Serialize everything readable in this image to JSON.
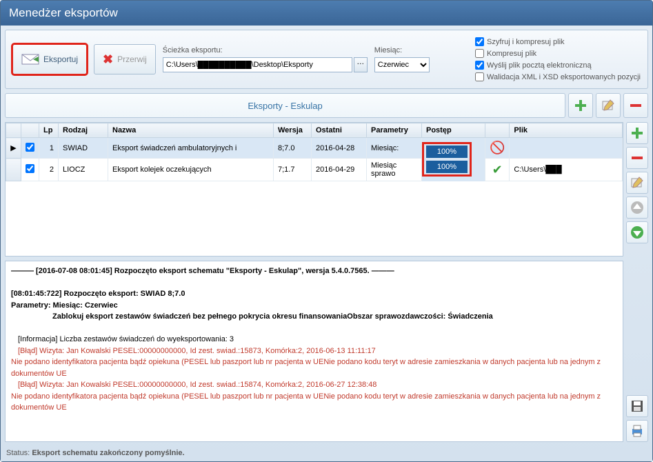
{
  "window": {
    "title": "Menedżer eksportów"
  },
  "toolbar": {
    "export_label": "Eksportuj",
    "cancel_label": "Przerwij",
    "path_label": "Ścieżka eksportu:",
    "path_value": "C:\\Users\\██████████\\Desktop\\Eksporty",
    "month_label": "Miesiąc:",
    "month_value": "Czerwiec"
  },
  "checks": {
    "encrypt": {
      "label": "Szyfruj i kompresuj plik",
      "checked": true
    },
    "compress": {
      "label": "Kompresuj plik",
      "checked": false
    },
    "email": {
      "label": "Wyślij plik pocztą elektroniczną",
      "checked": true
    },
    "validate": {
      "label": "Walidacja XML i XSD eksportowanych pozycji",
      "checked": false
    }
  },
  "schema": {
    "name": "Eksporty - Eskulap"
  },
  "grid": {
    "headers": {
      "lp": "Lp",
      "rodzaj": "Rodzaj",
      "nazwa": "Nazwa",
      "wersja": "Wersja",
      "ostatni": "Ostatni",
      "parametry": "Parametry",
      "postep": "Postęp",
      "plik": "Plik"
    },
    "rows": [
      {
        "selected": true,
        "checked": true,
        "lp": "1",
        "rodzaj": "SWIAD",
        "nazwa": "Eksport świadczeń ambulatoryjnych i",
        "wersja": "8;7.0",
        "ostatni": "2016-04-28",
        "parametry": "Miesiąc:",
        "postep": "100%",
        "status": "error",
        "plik": ""
      },
      {
        "selected": false,
        "checked": true,
        "lp": "2",
        "rodzaj": "LIOCZ",
        "nazwa": "Eksport kolejek oczekujących",
        "wersja": "7;1.7",
        "ostatni": "2016-04-29",
        "parametry": "Miesiąc sprawo",
        "postep": "100%",
        "status": "ok",
        "plik": "C:\\Users\\███"
      }
    ]
  },
  "log": {
    "line1": "——— [2016-07-08 08:01:45] Rozpoczęto eksport schematu \"Eksporty - Eskulap\", wersja 5.4.0.7565. ———",
    "line2": "[08:01:45:722] Rozpoczęto eksport: SWIAD 8;7.0",
    "line3": "Parametry: Miesiąc: Czerwiec",
    "line4": "Zablokuj eksport zestawów świadczeń bez pełnego pokrycia okresu finansowaniaObszar sprawozdawczości: Świadczenia",
    "line5": "[Informacja] Liczba zestawów świadczeń do wyeksportowania: 3",
    "err1": "[Błąd] Wizyta: Jan Kowalski PESEL:00000000000, Id zest. swiad.:15873, Komórka:2, 2016-06-13 11:11:17",
    "err1b": "Nie podano identyfikatora pacjenta bądź opiekuna (PESEL lub paszport lub nr pacjenta w UENie podano kodu teryt w adresie zamieszkania w danych pacjenta lub na jednym z dokumentów UE",
    "err2": "[Błąd] Wizyta: Jan Kowalski PESEL:00000000000, Id zest. swiad.:15874, Komórka:2, 2016-06-27 12:38:48",
    "err2b": "Nie podano identyfikatora pacjenta bądź opiekuna (PESEL lub paszport lub nr pacjenta w UENie podano kodu teryt w adresie zamieszkania w danych pacjenta lub na jednym z dokumentów UE"
  },
  "status": {
    "label": "Status:",
    "text": "Eksport schematu zakończony pomyślnie."
  }
}
